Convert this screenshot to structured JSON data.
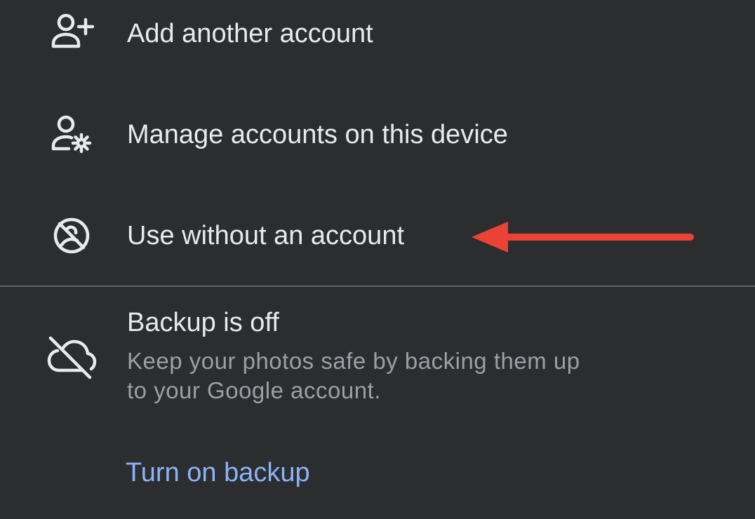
{
  "menu": {
    "items": [
      {
        "label": "Add another account",
        "icon": "add-person-icon"
      },
      {
        "label": "Manage accounts on this device",
        "icon": "manage-accounts-icon"
      },
      {
        "label": "Use without an account",
        "icon": "no-account-icon"
      }
    ]
  },
  "backup": {
    "icon": "cloud-off-icon",
    "title": "Backup is off",
    "line1": "Keep your photos safe by backing them up",
    "line2": "to your Google account.",
    "action": "Turn on backup"
  },
  "annotation": {
    "arrow_color": "#ea4335"
  },
  "colors": {
    "background": "#2c2d2f",
    "text": "#e8eaed",
    "secondary_text": "#9aa0a6",
    "link": "#8ab4f8",
    "divider": "#5f6368"
  }
}
